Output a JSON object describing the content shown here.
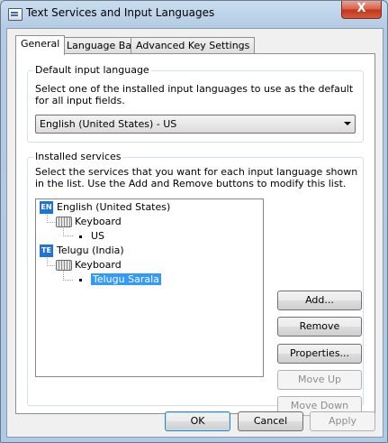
{
  "window": {
    "title": "Text Services and Input Languages",
    "close_glyph": "X"
  },
  "tabs": [
    {
      "label": "General",
      "active": true
    },
    {
      "label": "Language Bar",
      "active": false
    },
    {
      "label": "Advanced Key Settings",
      "active": false
    }
  ],
  "default_input": {
    "group_title": "Default input language",
    "description": "Select one of the installed input languages to use as the default for all input fields.",
    "selected": "English (United States) - US"
  },
  "installed_services": {
    "group_title": "Installed services",
    "description": "Select the services that you want for each input language shown in the list. Use the Add and Remove buttons to modify this list.",
    "tree": [
      {
        "badge": "EN",
        "label": "English (United States)",
        "category": "Keyboard",
        "service": "US",
        "service_selected": false
      },
      {
        "badge": "TE",
        "label": "Telugu (India)",
        "category": "Keyboard",
        "service": "Telugu Sarala",
        "service_selected": true
      }
    ],
    "buttons": {
      "add": "Add...",
      "remove": "Remove",
      "properties": "Properties...",
      "move_up": "Move Up",
      "move_down": "Move Down"
    }
  },
  "footer": {
    "ok": "OK",
    "cancel": "Cancel",
    "apply": "Apply"
  },
  "icons": {
    "app": "text-services-icon",
    "keyboard": "keyboard-icon",
    "close": "close-icon"
  },
  "colors": {
    "selection": "#3399ff",
    "badge": "#1e74d6",
    "close_button": "#c2351c"
  }
}
